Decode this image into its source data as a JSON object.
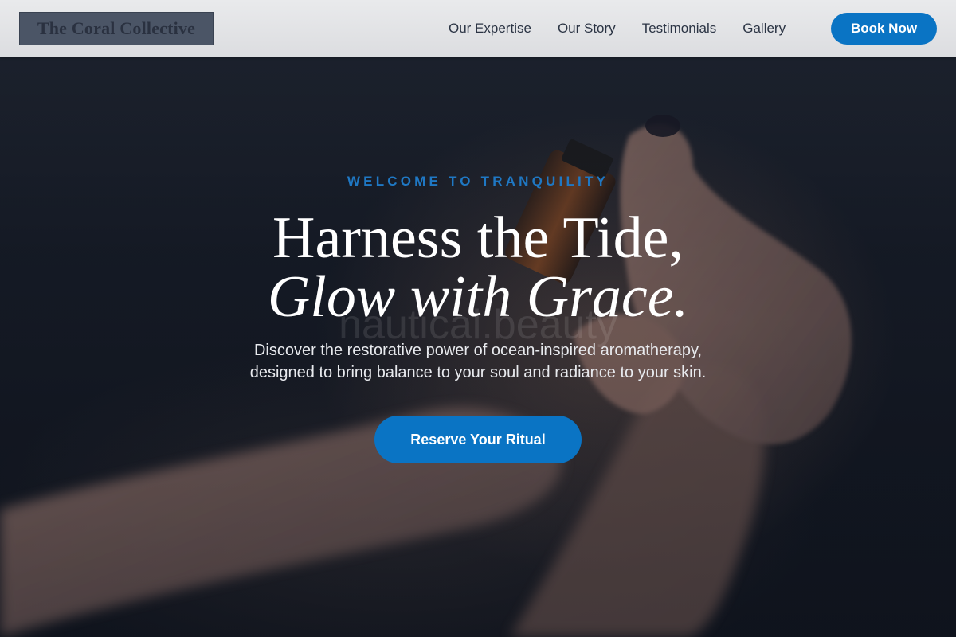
{
  "brand": {
    "name": "The Coral Collective"
  },
  "nav": {
    "links": [
      "Our Expertise",
      "Our Story",
      "Testimonials",
      "Gallery"
    ],
    "book_label": "Book Now"
  },
  "hero": {
    "eyebrow": "WELCOME TO TRANQUILITY",
    "headline_line1": "Harness the Tide,",
    "headline_line2": "Glow with Grace.",
    "watermark": "nautical.beauty",
    "subtext_line1": "Discover the restorative power of ocean-inspired aromatherapy,",
    "subtext_line2": "designed to bring balance to your soul and radiance to your skin.",
    "cta_label": "Reserve Your Ritual",
    "image_description_icon": "hands-holding-oil-bottle-photo"
  },
  "colors": {
    "accent": "#0a74c4",
    "eyebrow": "#1f78c4",
    "navbar_bg": "#e4e5e7",
    "logo_bg": "#4b5566",
    "nav_text": "#2b3444",
    "hero_bg": "#161b26"
  }
}
